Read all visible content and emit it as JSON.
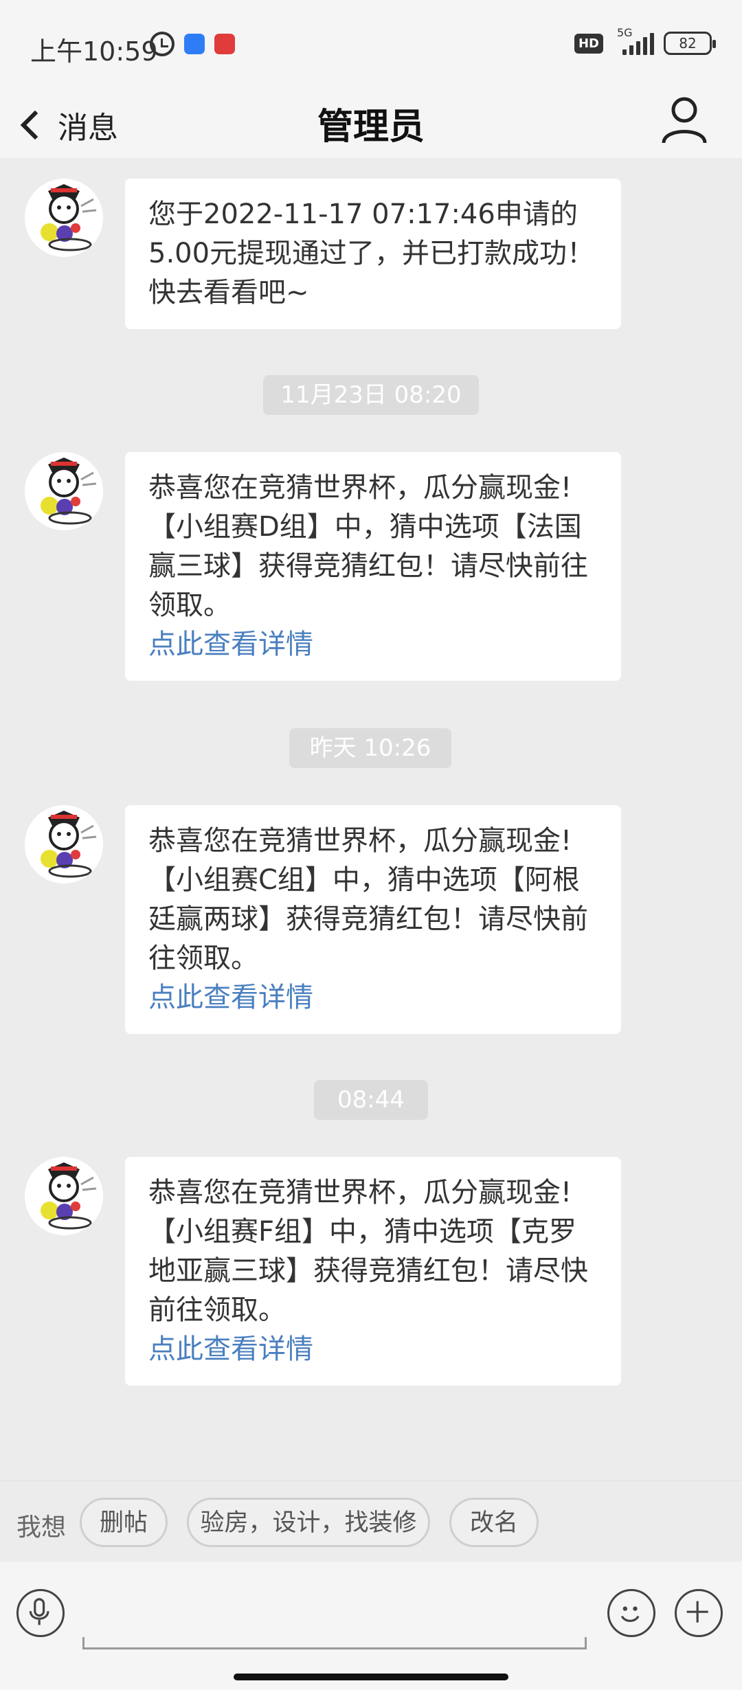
{
  "status_bar": {
    "time": "上午10:59",
    "network": "5G",
    "hd_label": "HD",
    "battery": "82"
  },
  "header": {
    "back_label": "消息",
    "title": "管理员"
  },
  "messages": [
    {
      "text": "您于2022-11-17 07:17:46申请的5.00元提现通过了，并已打款成功！快去看看吧~"
    },
    {
      "timestamp": "11月23日 08:20",
      "text": "恭喜您在竞猜世界杯，瓜分赢现金!【小组赛D组】中，猜中选项【法国赢三球】获得竞猜红包！请尽快前往领取。",
      "link": "点此查看详情"
    },
    {
      "timestamp": "昨天 10:26",
      "text": "恭喜您在竞猜世界杯，瓜分赢现金!【小组赛C组】中，猜中选项【阿根廷赢两球】获得竞猜红包！请尽快前往领取。",
      "link": "点此查看详情"
    },
    {
      "timestamp": "08:44",
      "text": "恭喜您在竞猜世界杯，瓜分赢现金!【小组赛F组】中，猜中选项【克罗地亚赢三球】获得竞猜红包！请尽快前往领取。",
      "link": "点此查看详情"
    }
  ],
  "quick_replies": {
    "label": "我想",
    "chips": [
      "删帖",
      "验房，设计，找装修",
      "改名"
    ]
  },
  "colors": {
    "link": "#4a7fbf",
    "background": "#ececec",
    "bubble": "#ffffff"
  }
}
